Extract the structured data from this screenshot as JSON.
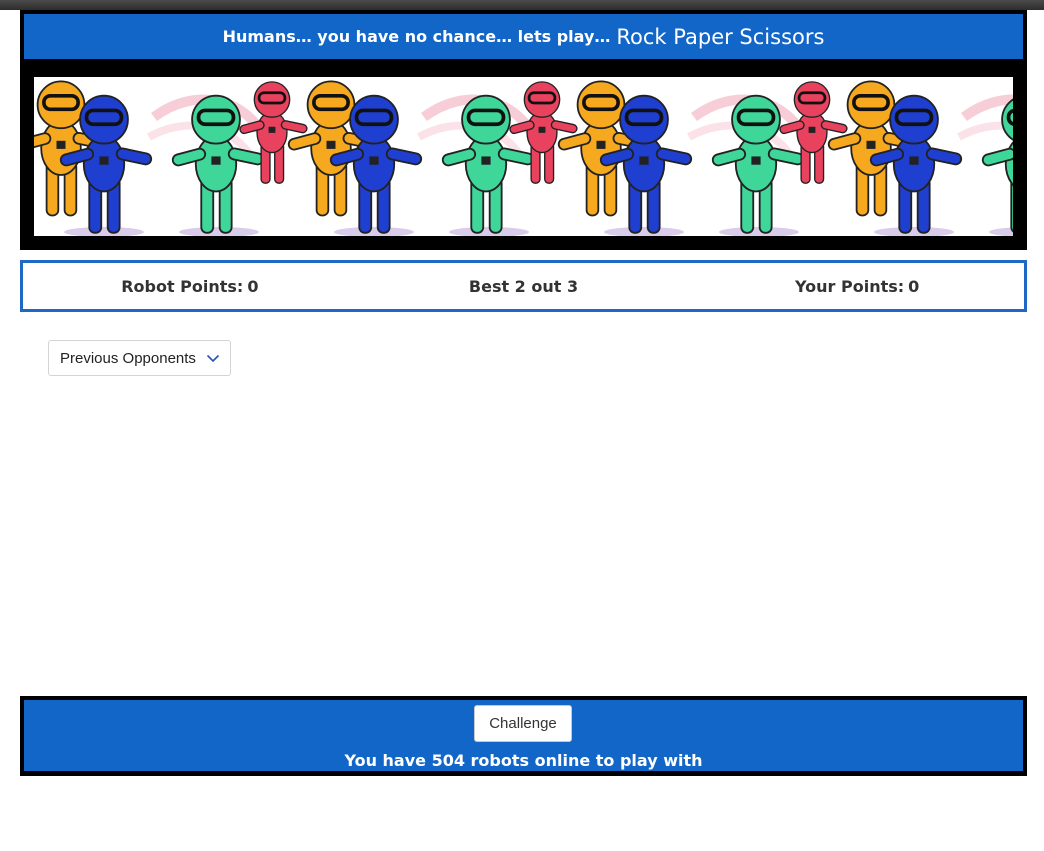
{
  "header": {
    "subtitle": "Humans… you have no chance… lets play…",
    "title": "Rock Paper Scissors"
  },
  "banner": {
    "robot_colors": [
      "#f6a81e",
      "#1f3fd1",
      "#3fd69a",
      "#e8425e"
    ],
    "repeat_count": 4
  },
  "scoreboard": {
    "robot_label": "Robot Points:",
    "robot_points": "0",
    "mode": "Best 2 out 3",
    "your_label": "Your Points:",
    "your_points": "0"
  },
  "opponents_dropdown": {
    "label": "Previous Opponents",
    "icon": "chevron-down-icon"
  },
  "footer": {
    "challenge_label": "Challenge",
    "online_text": "You have 504 robots online to play with"
  },
  "colors": {
    "primary_blue": "#1266c8",
    "frame_black": "#000000",
    "score_border": "#1f68c6"
  }
}
